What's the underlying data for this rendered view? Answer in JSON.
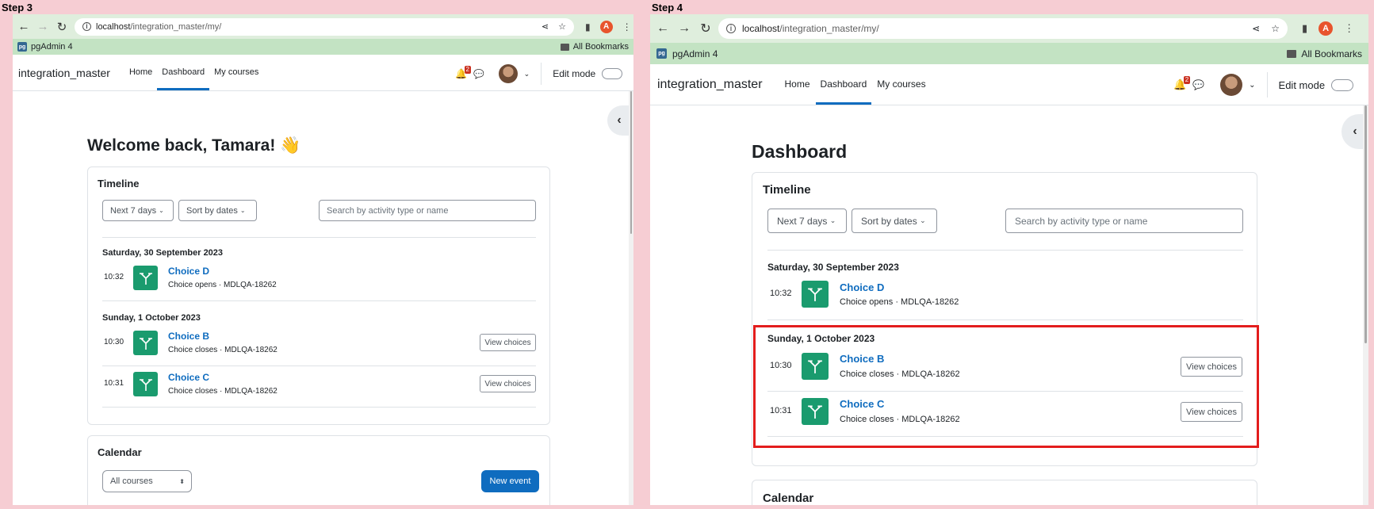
{
  "steps": [
    {
      "label": "Step 3",
      "browser": {
        "url_host": "localhost",
        "url_path": "/integration_master/my/",
        "bookmark_app": "pgAdmin 4",
        "bookmarks_folder": "All Bookmarks",
        "profile_initial": "A"
      },
      "moodle": {
        "site_name": "integration_master",
        "nav": [
          "Home",
          "Dashboard",
          "My courses"
        ],
        "notifications_count": "2",
        "edit_mode_label": "Edit mode"
      },
      "page_title": "Welcome back, Tamara! 👋",
      "timeline": {
        "title": "Timeline",
        "filter_days": "Next 7 days",
        "sort": "Sort by dates",
        "search_placeholder": "Search by activity type or name",
        "groups": [
          {
            "date": "Saturday, 30 September 2023",
            "items": [
              {
                "time": "10:32",
                "title": "Choice D",
                "subtitle": "Choice opens · MDLQA-18262",
                "action": ""
              }
            ]
          },
          {
            "date": "Sunday, 1 October 2023",
            "items": [
              {
                "time": "10:30",
                "title": "Choice B",
                "subtitle": "Choice closes · MDLQA-18262",
                "action": "View choices"
              },
              {
                "time": "10:31",
                "title": "Choice C",
                "subtitle": "Choice closes · MDLQA-18262",
                "action": "View choices"
              }
            ]
          }
        ]
      },
      "calendar": {
        "title": "Calendar",
        "course_filter": "All courses",
        "new_event": "New event"
      }
    },
    {
      "label": "Step 4",
      "browser": {
        "url_host": "localhost",
        "url_path": "/integration_master/my/",
        "bookmark_app": "pgAdmin 4",
        "bookmarks_folder": "All Bookmarks",
        "profile_initial": "A"
      },
      "moodle": {
        "site_name": "integration_master",
        "nav": [
          "Home",
          "Dashboard",
          "My courses"
        ],
        "notifications_count": "2",
        "edit_mode_label": "Edit mode"
      },
      "page_title": "Dashboard",
      "timeline": {
        "title": "Timeline",
        "filter_days": "Next 7 days",
        "sort": "Sort by dates",
        "search_placeholder": "Search by activity type or name",
        "groups": [
          {
            "date": "Saturday, 30 September 2023",
            "items": [
              {
                "time": "10:32",
                "title": "Choice D",
                "subtitle": "Choice opens · MDLQA-18262",
                "action": ""
              }
            ]
          },
          {
            "date": "Sunday, 1 October 2023",
            "items": [
              {
                "time": "10:30",
                "title": "Choice B",
                "subtitle": "Choice closes · MDLQA-18262",
                "action": "View choices"
              },
              {
                "time": "10:31",
                "title": "Choice C",
                "subtitle": "Choice closes · MDLQA-18262",
                "action": "View choices"
              }
            ]
          }
        ]
      },
      "calendar": {
        "title": "Calendar"
      }
    }
  ],
  "colors": {
    "accent": "#0f6cbf",
    "activity_icon": "#1a9b6e",
    "highlight": "#e31d1d",
    "background": "#f6cdd3"
  },
  "icons": [
    "back-arrow-icon",
    "forward-arrow-icon",
    "reload-icon",
    "info-icon",
    "share-icon",
    "star-icon",
    "sidepanel-icon",
    "menu-dots-icon",
    "bell-icon",
    "chat-icon",
    "chevron-down-icon",
    "chevron-left-icon",
    "choice-activity-icon",
    "folder-icon"
  ]
}
